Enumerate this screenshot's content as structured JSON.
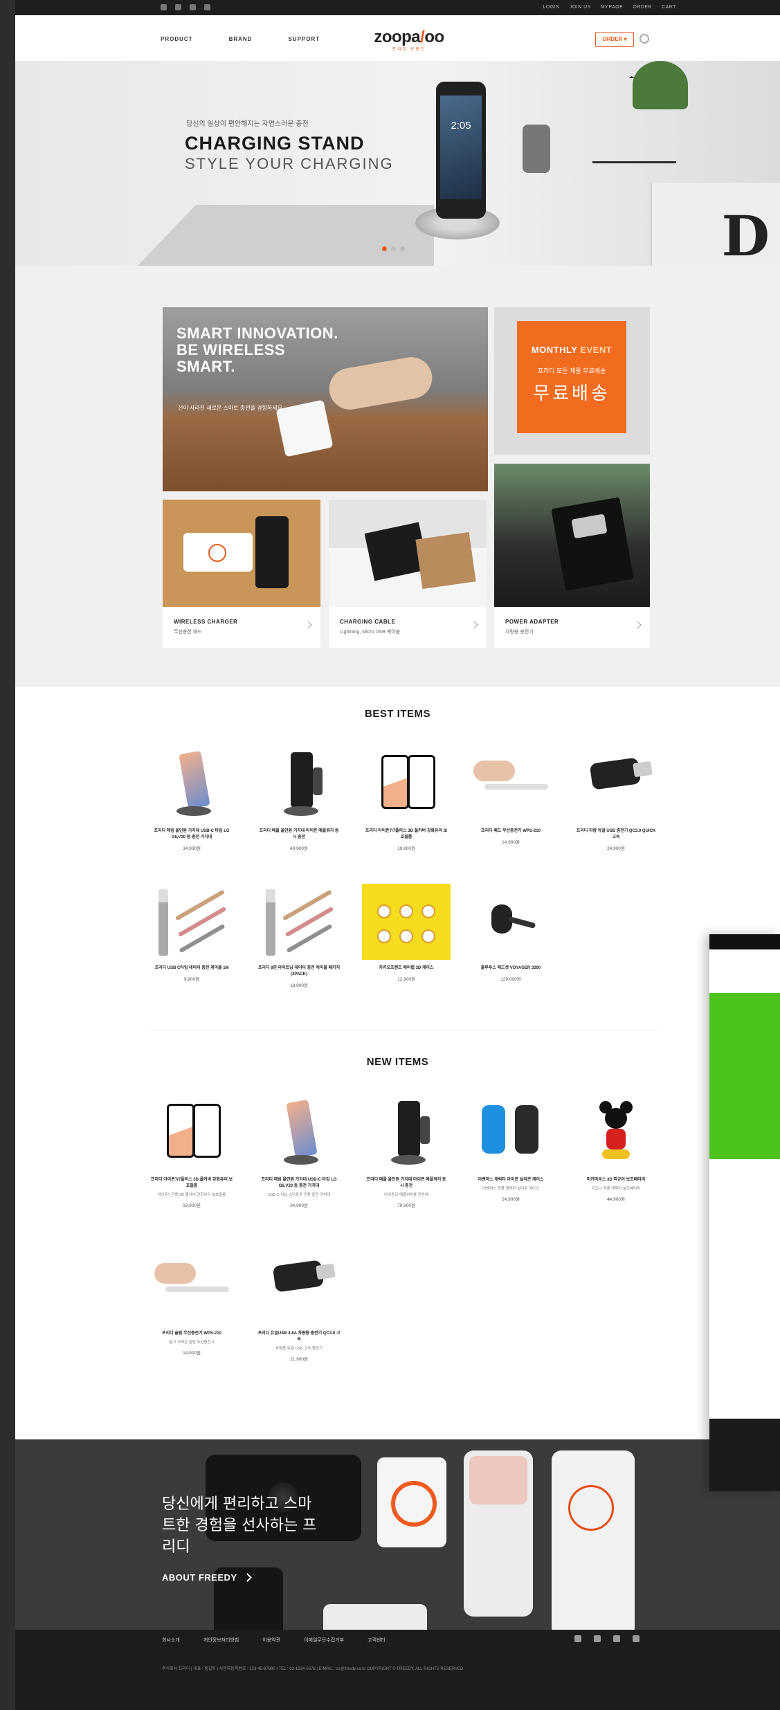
{
  "brand": {
    "logo_text_a": "zoopa",
    "logo_text_b": "/",
    "logo_text_c": "oo",
    "logo_sub": "프리디 브랜드",
    "accent_color": "#e85a1c"
  },
  "topbar": {
    "social_icons": [
      "facebook-icon",
      "instagram-icon",
      "youtube-icon",
      "blog-icon"
    ],
    "links": [
      "LOGIN",
      "JOIN US",
      "MYPAGE",
      "ORDER",
      "CART"
    ]
  },
  "header": {
    "nav": [
      "PRODUCT",
      "BRAND",
      "SUPPORT"
    ],
    "lang_button": "ORDER ▾"
  },
  "hero": {
    "kicker": "당신의 일상이 편안해지는 자연스러운 충전",
    "title": "CHARGING STAND",
    "subtitle": "STYLE YOUR CHARGING",
    "phone_clock": "2:05",
    "magazine_letter": "D",
    "slide_count": 3,
    "active_slide": 1
  },
  "tiles": {
    "smart": {
      "headline": "SMART INNOVATION. BE WIRELESS SMART.",
      "caption": "선이 사라진 새로운 스마트 충전을 경험하세요"
    },
    "event": {
      "title_a": "MONTHLY ",
      "title_b": "EVENT",
      "sub": "프리디 모든 제품 무료배송",
      "big": "무료배송"
    },
    "wireless": {
      "name": "WIRELESS CHARGER",
      "desc": "무선충전 패드"
    },
    "cable": {
      "name": "CHARGING CABLE",
      "desc": "Lightning, Micro USB 케이블"
    },
    "adapter": {
      "name": "POWER ADAPTER",
      "desc": "차량용 충전기"
    }
  },
  "best": {
    "title": "BEST ITEMS",
    "items": [
      {
        "name": "프리디 에빔 올인원 거치대 USB-C 타입 LG G6,V20 등 충전 거치대",
        "price": "34,900원"
      },
      {
        "name": "프리디 애플 올인원 거치대 아이폰 애플워치 동시 충전",
        "price": "49,900원"
      },
      {
        "name": "프리디 아이폰7/7플러스 3D 풀커버 강화유리 보호필름",
        "price": "19,900원"
      },
      {
        "name": "프리디 패드 무선충전기 WPS-210",
        "price": "14,900원"
      },
      {
        "name": "프리디 차량 듀얼 USB 충전기 QC3.0 QUICK 고속",
        "price": "24,900원"
      },
      {
        "name": "프리디 USB C타입 데이터 충전 케이블 1M",
        "price": "9,900원"
      },
      {
        "name": "프리디 8핀 라이트닝 데이터 충전 케이블 패키지 (3PACK)",
        "price": "18,900원"
      },
      {
        "name": "카카오프렌즈 에어캡 3D 케이스",
        "price": "12,900원"
      },
      {
        "name": "블루투스 헤드셋 VOYAGER 3200",
        "price": "129,000원"
      }
    ]
  },
  "new": {
    "title": "NEW ITEMS",
    "items": [
      {
        "name": "프리디 아이폰7/7플러스 3D 풀커버 강화유리 보호필름",
        "desc": "아이폰7 전용 3D 풀커버 강화유리 보호필름",
        "price": "19,900원"
      },
      {
        "name": "프리디 에빔 올인원 거치대 USB-C 타입 LG G6,V20 등 충전 거치대",
        "desc": "USB-C 타입 스마트폰 전용 충전 거치대",
        "price": "34,900원"
      },
      {
        "name": "프리디 애플 올인원 거치대 아이폰 애플워치 동시 충전",
        "desc": "아이폰과 애플워치를 한번에",
        "price": "79,900원"
      },
      {
        "name": "어벤져스 캐릭터 아이폰 실리콘 케이스",
        "desc": "어벤져스 정품 캐릭터 실리콘 케이스",
        "price": "24,900원"
      },
      {
        "name": "미키마우스 3D 피규어 보조배터리",
        "desc": "디즈니 정품 캐릭터 보조배터리",
        "price": "44,900원"
      },
      {
        "name": "프리디 슬림 무선충전기 WPS-210",
        "desc": "얇고 가벼운 슬림 무선충전기",
        "price": "14,900원"
      },
      {
        "name": "프리디 듀얼USB 4.8A 차량용 충전기 QC3.0 고속",
        "desc": "차량용 듀얼 USB 고속 충전기",
        "price": "21,900원"
      }
    ]
  },
  "about": {
    "tagline": "당신에게 편리하고 스마트한 경험을 선사하는 프리디",
    "link": "ABOUT FREEDY"
  },
  "footer": {
    "nav": [
      "회사소개",
      "개인정보처리방침",
      "이용약관",
      "이메일무단수집거부",
      "고객센터"
    ],
    "info": "주식회사 프리디 | 대표 : 홍길동 | 사업자등록번호 : 123-45-67890 | TEL : 02-1234-5678 | E-MAIL : cs@freedy.co.kr  COPYRIGHT © FREEDY. ALL RIGHTS RESERVED."
  }
}
